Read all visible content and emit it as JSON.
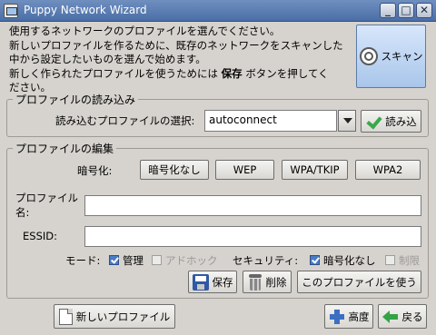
{
  "window": {
    "title": "Puppy Network Wizard",
    "minimize_label": "_",
    "maximize_label": "□",
    "close_label": "✕"
  },
  "intro": {
    "line1": "使用するネットワークのプロファイルを選んでください。",
    "line2": "新しいプロファイルを作るために、既存のネットワークをスキャンした",
    "line3": "中から設定したいものを選んで始めます。",
    "line4_before": "新しく作られたプロファイルを使うためには",
    "line4_bold": "保存",
    "line4_after": "ボタンを押してく",
    "line5": "ださい。"
  },
  "scan_button": {
    "label": "スキャン",
    "icon": "scan-icon"
  },
  "load_section": {
    "legend": "プロファイルの読み込み",
    "select_label": "読み込むプロファイルの選択:",
    "selected_value": "autoconnect",
    "load_button": "読み込"
  },
  "edit_section": {
    "legend": "プロファイルの編集",
    "encryption_label": "暗号化:",
    "encryption_buttons": [
      "暗号化なし",
      "WEP",
      "WPA/TKIP",
      "WPA2"
    ],
    "profile_name_label_1": "プロファイル",
    "profile_name_label_2": "名:",
    "profile_name_value": "",
    "essid_label": "ESSID:",
    "essid_value": "",
    "mode_label": "モード:",
    "mode_managed": {
      "label": "管理",
      "checked": true,
      "enabled": true
    },
    "mode_adhoc": {
      "label": "アドホック",
      "checked": false,
      "enabled": false
    },
    "security_label": "セキュリティ:",
    "security_none": {
      "label": "暗号化なし",
      "checked": true,
      "enabled": true
    },
    "security_restricted": {
      "label": "制限",
      "checked": false,
      "enabled": false
    },
    "save_button": "保存",
    "delete_button": "削除",
    "use_profile_button": "このプロファイルを使う"
  },
  "footer": {
    "new_profile_button": "新しいプロファイル",
    "advanced_button": "高度",
    "back_button": "戻る"
  },
  "colors": {
    "window_bg": "#d6d3ce",
    "titlebar": "#4a6ea6",
    "scan_button": "#a9c6ea",
    "check_accent": "#4c7ac4"
  }
}
